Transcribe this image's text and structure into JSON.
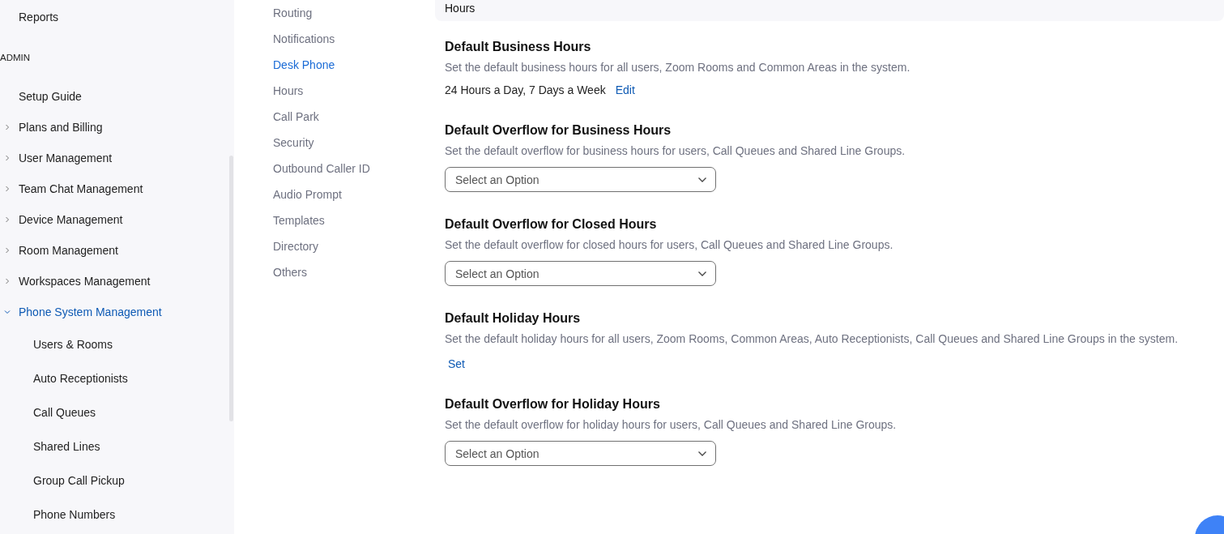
{
  "sidebar": {
    "top_items": [
      {
        "label": "Reports"
      }
    ],
    "section_label": "ADMIN",
    "items": [
      {
        "kind": "link",
        "label": "Setup Guide"
      },
      {
        "kind": "group",
        "label": "Plans and Billing",
        "expanded": false
      },
      {
        "kind": "group",
        "label": "User Management",
        "expanded": false
      },
      {
        "kind": "group",
        "label": "Team Chat Management",
        "expanded": false
      },
      {
        "kind": "group",
        "label": "Device Management",
        "expanded": false
      },
      {
        "kind": "group",
        "label": "Room Management",
        "expanded": false
      },
      {
        "kind": "group",
        "label": "Workspaces Management",
        "expanded": false
      },
      {
        "kind": "group",
        "label": "Phone System Management",
        "expanded": true,
        "children": [
          {
            "label": "Users & Rooms"
          },
          {
            "label": "Auto Receptionists"
          },
          {
            "label": "Call Queues"
          },
          {
            "label": "Shared Lines"
          },
          {
            "label": "Group Call Pickup"
          },
          {
            "label": "Phone Numbers"
          }
        ]
      }
    ]
  },
  "settings_nav": [
    {
      "label": "Routing",
      "selected": false
    },
    {
      "label": "Notifications",
      "selected": false
    },
    {
      "label": "Desk Phone",
      "selected": true
    },
    {
      "label": "Hours",
      "selected": false
    },
    {
      "label": "Call Park",
      "selected": false
    },
    {
      "label": "Security",
      "selected": false
    },
    {
      "label": "Outbound Caller ID",
      "selected": false
    },
    {
      "label": "Audio Prompt",
      "selected": false
    },
    {
      "label": "Templates",
      "selected": false
    },
    {
      "label": "Directory",
      "selected": false
    },
    {
      "label": "Others",
      "selected": false
    }
  ],
  "section_header": "Hours",
  "settings": [
    {
      "kind": "value",
      "title": "Default Business Hours",
      "description": "Set the default business hours for all users, Zoom Rooms and Common Areas in the system.",
      "value": "24 Hours a Day, 7 Days a Week",
      "link": "Edit"
    },
    {
      "kind": "select",
      "title": "Default Overflow for Business Hours",
      "description": "Set the default overflow for business hours for users, Call Queues and Shared Line Groups.",
      "placeholder": "Select an Option"
    },
    {
      "kind": "select",
      "title": "Default Overflow for Closed Hours",
      "description": "Set the default overflow for closed hours for users, Call Queues and Shared Line Groups.",
      "placeholder": "Select an Option"
    },
    {
      "kind": "link",
      "title": "Default Holiday Hours",
      "description": "Set the default holiday hours for all users, Zoom Rooms, Common Areas, Auto Receptionists, Call Queues and Shared Line Groups in the system.",
      "link": "Set"
    },
    {
      "kind": "select",
      "title": "Default Overflow for Holiday Hours",
      "description": "Set the default overflow for holiday hours for users, Call Queues and Shared Line Groups.",
      "placeholder": "Select an Option"
    }
  ]
}
